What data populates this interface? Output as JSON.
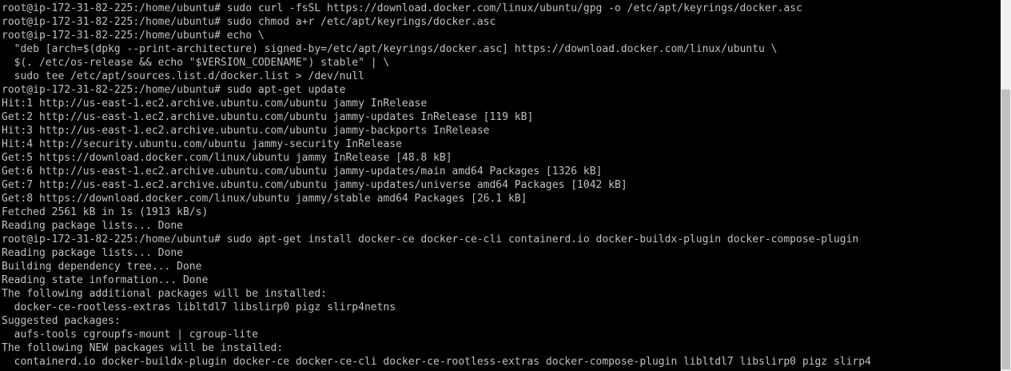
{
  "terminal": {
    "lines": [
      "root@ip-172-31-82-225:/home/ubuntu# sudo curl -fsSL https://download.docker.com/linux/ubuntu/gpg -o /etc/apt/keyrings/docker.asc",
      "root@ip-172-31-82-225:/home/ubuntu# sudo chmod a+r /etc/apt/keyrings/docker.asc",
      "root@ip-172-31-82-225:/home/ubuntu# echo \\",
      "  \"deb [arch=$(dpkg --print-architecture) signed-by=/etc/apt/keyrings/docker.asc] https://download.docker.com/linux/ubuntu \\",
      "  $(. /etc/os-release && echo \"$VERSION_CODENAME\") stable\" | \\",
      "  sudo tee /etc/apt/sources.list.d/docker.list > /dev/null",
      "root@ip-172-31-82-225:/home/ubuntu# sudo apt-get update",
      "Hit:1 http://us-east-1.ec2.archive.ubuntu.com/ubuntu jammy InRelease",
      "Get:2 http://us-east-1.ec2.archive.ubuntu.com/ubuntu jammy-updates InRelease [119 kB]",
      "Hit:3 http://us-east-1.ec2.archive.ubuntu.com/ubuntu jammy-backports InRelease",
      "Hit:4 http://security.ubuntu.com/ubuntu jammy-security InRelease",
      "Get:5 https://download.docker.com/linux/ubuntu jammy InRelease [48.8 kB]",
      "Get:6 http://us-east-1.ec2.archive.ubuntu.com/ubuntu jammy-updates/main amd64 Packages [1326 kB]",
      "Get:7 http://us-east-1.ec2.archive.ubuntu.com/ubuntu jammy-updates/universe amd64 Packages [1042 kB]",
      "Get:8 https://download.docker.com/linux/ubuntu jammy/stable amd64 Packages [26.1 kB]",
      "Fetched 2561 kB in 1s (1913 kB/s)",
      "Reading package lists... Done",
      "root@ip-172-31-82-225:/home/ubuntu# sudo apt-get install docker-ce docker-ce-cli containerd.io docker-buildx-plugin docker-compose-plugin",
      "Reading package lists... Done",
      "Building dependency tree... Done",
      "Reading state information... Done",
      "The following additional packages will be installed:",
      "  docker-ce-rootless-extras libltdl7 libslirp0 pigz slirp4netns",
      "Suggested packages:",
      "  aufs-tools cgroupfs-mount | cgroup-lite",
      "The following NEW packages will be installed:",
      "  containerd.io docker-buildx-plugin docker-ce docker-ce-cli docker-ce-rootless-extras docker-compose-plugin libltdl7 libslirp0 pigz slirp4"
    ]
  },
  "colors": {
    "background": "#000000",
    "text": "#c0c0c0",
    "scrollbar_track": "#f0f0f0",
    "scrollbar_thumb": "#c1c1c1"
  }
}
